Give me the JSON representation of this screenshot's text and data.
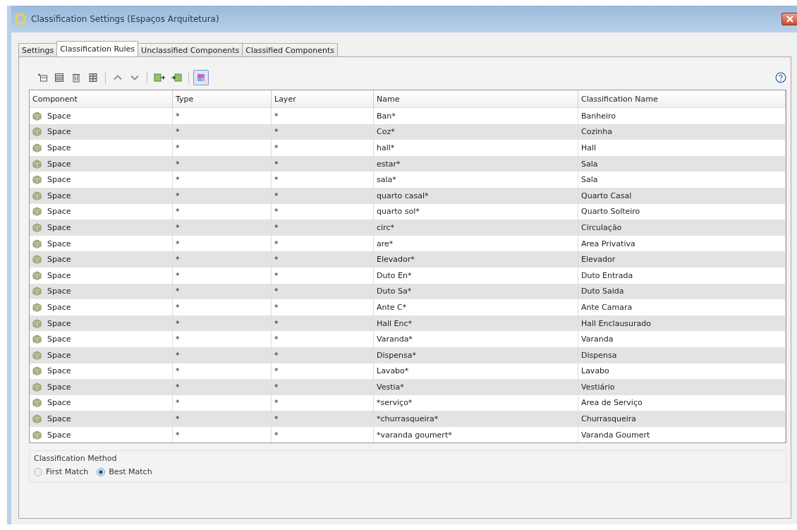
{
  "window": {
    "title": "Classification Settings (Espaços Arquitetura)"
  },
  "tabs": [
    {
      "label": "Settings",
      "selected": false
    },
    {
      "label": "Classification Rules",
      "selected": true
    },
    {
      "label": "Unclassified Components",
      "selected": false
    },
    {
      "label": "Classified Components",
      "selected": false
    }
  ],
  "toolbar": [
    {
      "kind": "add",
      "pressed": false
    },
    {
      "kind": "insert",
      "pressed": false
    },
    {
      "kind": "delete",
      "pressed": false
    },
    {
      "kind": "copy",
      "pressed": false
    },
    {
      "kind": "sep"
    },
    {
      "kind": "up",
      "pressed": false
    },
    {
      "kind": "down",
      "pressed": false
    },
    {
      "kind": "sep"
    },
    {
      "kind": "import",
      "pressed": false
    },
    {
      "kind": "export",
      "pressed": false
    },
    {
      "kind": "sep"
    },
    {
      "kind": "color",
      "pressed": true
    }
  ],
  "table": {
    "columns": [
      "Component",
      "Type",
      "Layer",
      "Name",
      "Classification Name"
    ],
    "rows": [
      [
        "Space",
        "*",
        "*",
        "Ban*",
        "Banheiro"
      ],
      [
        "Space",
        "*",
        "*",
        "Coz*",
        "Cozinha"
      ],
      [
        "Space",
        "*",
        "*",
        "hall*",
        "Hall"
      ],
      [
        "Space",
        "*",
        "*",
        "estar*",
        "Sala"
      ],
      [
        "Space",
        "*",
        "*",
        "sala*",
        "Sala"
      ],
      [
        "Space",
        "*",
        "*",
        "quarto casal*",
        "Quarto Casal"
      ],
      [
        "Space",
        "*",
        "*",
        "quarto sol*",
        "Quarto Solteiro"
      ],
      [
        "Space",
        "*",
        "*",
        "circ*",
        "Circulação"
      ],
      [
        "Space",
        "*",
        "*",
        "are*",
        "Area Privativa"
      ],
      [
        "Space",
        "*",
        "*",
        "Elevador*",
        "Elevador"
      ],
      [
        "Space",
        "*",
        "*",
        "Duto En*",
        "Duto Entrada"
      ],
      [
        "Space",
        "*",
        "*",
        "Duto Sa*",
        "Duto Saida"
      ],
      [
        "Space",
        "*",
        "*",
        "Ante C*",
        "Ante Camara"
      ],
      [
        "Space",
        "*",
        "*",
        "Hall Enc*",
        "Hall Enclausurado"
      ],
      [
        "Space",
        "*",
        "*",
        "Varanda*",
        "Varanda"
      ],
      [
        "Space",
        "*",
        "*",
        "Dispensa*",
        "Dispensa"
      ],
      [
        "Space",
        "*",
        "*",
        "Lavabo*",
        "Lavabo"
      ],
      [
        "Space",
        "*",
        "*",
        "Vestia*",
        "Vestiário"
      ],
      [
        "Space",
        "*",
        "*",
        "*serviço*",
        "Area de Serviço"
      ],
      [
        "Space",
        "*",
        "*",
        "*churrasqueira*",
        "Churrasqueira"
      ],
      [
        "Space",
        "*",
        "*",
        "*varanda goumert*",
        "Varanda Goumert"
      ]
    ]
  },
  "classification_method": {
    "title": "Classification Method",
    "options": [
      {
        "label": "First Match",
        "selected": false
      },
      {
        "label": "Best Match",
        "selected": true
      }
    ]
  }
}
